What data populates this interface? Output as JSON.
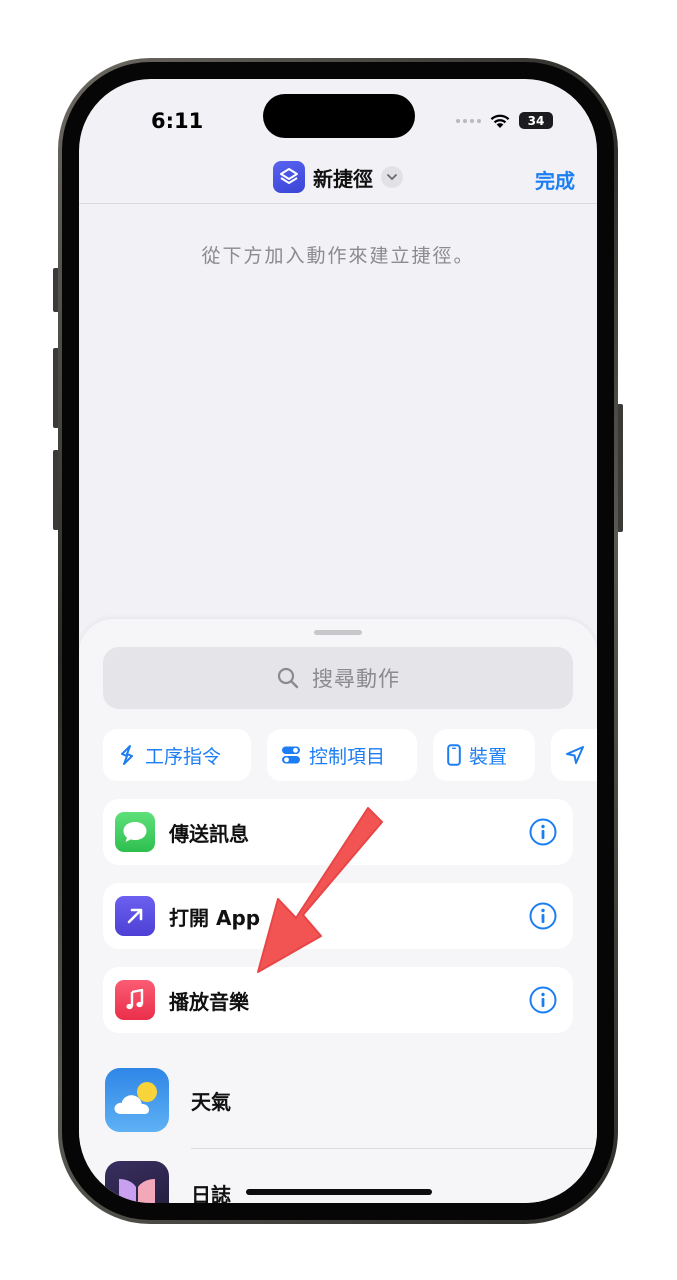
{
  "status": {
    "time": "6:11",
    "battery": "34"
  },
  "nav": {
    "title": "新捷徑",
    "done_label": "完成"
  },
  "hint": "從下方加入動作來建立捷徑。",
  "search": {
    "placeholder": "搜尋動作"
  },
  "categories": [
    {
      "label": "工序指令",
      "icon": "scripting-icon"
    },
    {
      "label": "控制項目",
      "icon": "toggle-icon"
    },
    {
      "label": "裝置",
      "icon": "phone-device-icon"
    },
    {
      "label": "",
      "icon": "location-arrow-icon"
    }
  ],
  "suggestions": [
    {
      "label": "傳送訊息",
      "icon": "messages-icon",
      "color": "#35c759"
    },
    {
      "label": "打開 App",
      "icon": "open-app-icon",
      "color": "#5b4fe0"
    },
    {
      "label": "播放音樂",
      "icon": "music-icon",
      "color": "#f53d55"
    }
  ],
  "apps": [
    {
      "label": "天氣",
      "icon": "weather-icon"
    },
    {
      "label": "日誌",
      "icon": "journal-icon"
    }
  ],
  "colors": {
    "accent": "#1c7ef2",
    "annotation_arrow": "#f25454"
  }
}
